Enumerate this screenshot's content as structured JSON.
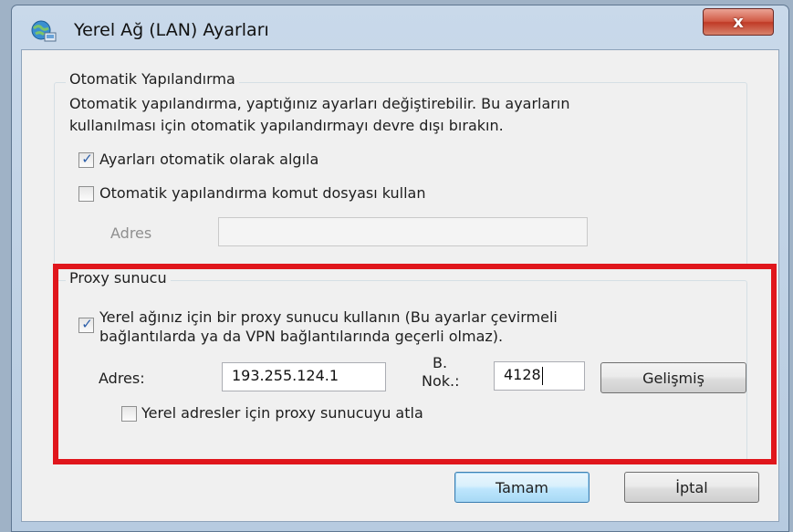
{
  "window": {
    "title": "Yerel Ağ (LAN) Ayarları",
    "close_label": "x"
  },
  "auto_config": {
    "legend": "Otomatik Yapılandırma",
    "description_line1": "Otomatik yapılandırma, yaptığınız ayarları değiştirebilir. Bu ayarların",
    "description_line2": "kullanılması için otomatik yapılandırmayı devre dışı bırakın.",
    "detect_label": "Ayarları otomatik olarak algıla",
    "detect_checked": true,
    "script_label": "Otomatik yapılandırma komut dosyası kullan",
    "script_checked": false,
    "address_label": "Adres",
    "address_value": ""
  },
  "proxy": {
    "legend": "Proxy sunucu",
    "use_proxy_line1": "Yerel ağınız için bir proxy sunucu kullanın (Bu ayarlar çevirmeli",
    "use_proxy_line2": "bağlantılarda ya da VPN bağlantılarında geçerli olmaz).",
    "use_proxy_checked": true,
    "address_label": "Adres:",
    "address_value": "193.255.124.1",
    "port_label_line1": "B.",
    "port_label_line2": "Nok.:",
    "port_value": "4128",
    "advanced_label": "Gelişmiş",
    "bypass_label": "Yerel adresler için proxy sunucuyu atla",
    "bypass_checked": false
  },
  "buttons": {
    "ok_label": "Tamam",
    "cancel_label": "İptal"
  },
  "colors": {
    "highlight": "#e0161c",
    "check": "#2a5da8"
  }
}
